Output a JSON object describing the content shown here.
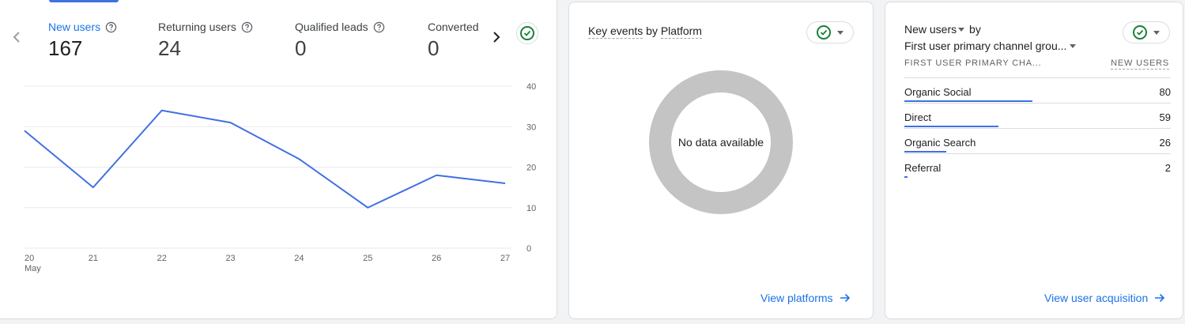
{
  "overview": {
    "metrics": [
      {
        "label": "New users",
        "value": "167"
      },
      {
        "label": "Returning users",
        "value": "24"
      },
      {
        "label": "Qualified leads",
        "value": "0"
      },
      {
        "label": "Converted",
        "value": "0"
      }
    ]
  },
  "chart_data": {
    "type": "line",
    "categories": [
      "20",
      "21",
      "22",
      "23",
      "24",
      "25",
      "26",
      "27"
    ],
    "month_label": "May",
    "values": [
      29,
      15,
      34,
      31,
      22,
      10,
      18,
      16
    ],
    "ylim": [
      0,
      40
    ],
    "yticks": [
      "0",
      "10",
      "20",
      "30",
      "40"
    ],
    "grid": true,
    "line_color": "#4170e0",
    "title": "",
    "xlabel": "",
    "ylabel": ""
  },
  "platform": {
    "title_part1": "Key events",
    "title_by": "by",
    "title_part2": "Platform",
    "empty_text": "No data available",
    "link": "View platforms"
  },
  "acquisition": {
    "title_metric": "New users",
    "title_by": "by",
    "title_dimension": "First user primary channel grou...",
    "col_dim": "FIRST USER PRIMARY CHA...",
    "col_metric": "NEW USERS",
    "rows": [
      {
        "label": "Organic Social",
        "value": "80",
        "share": 1.0
      },
      {
        "label": "Direct",
        "value": "59",
        "share": 0.7375
      },
      {
        "label": "Organic Search",
        "value": "26",
        "share": 0.325
      },
      {
        "label": "Referral",
        "value": "2",
        "share": 0.025
      }
    ],
    "link": "View user acquisition"
  },
  "colors": {
    "accent": "#1a73e8",
    "series": "#4170e0",
    "check": "#188038"
  }
}
